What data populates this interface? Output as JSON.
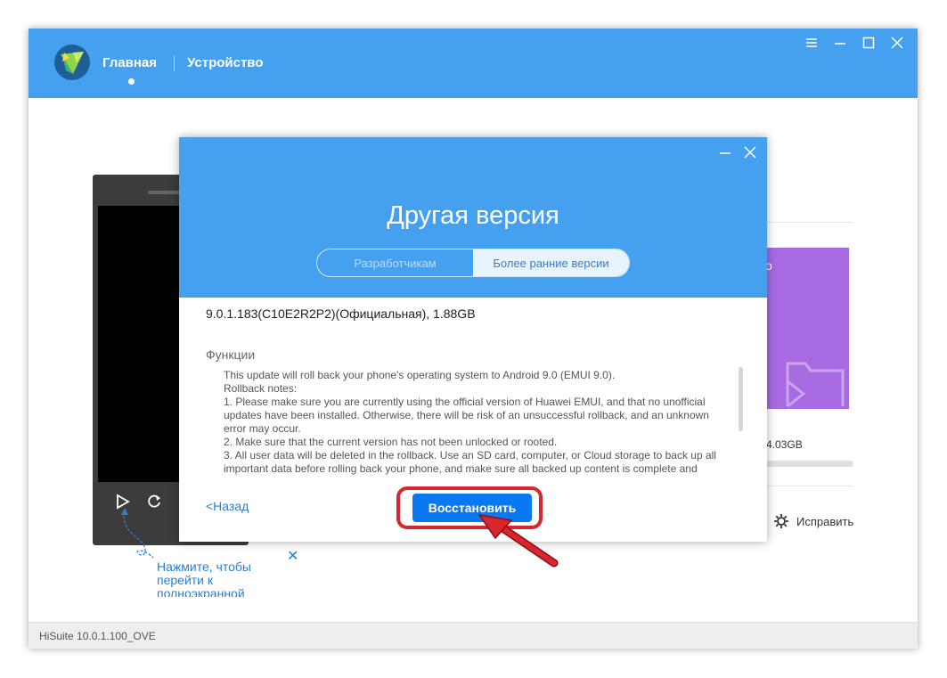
{
  "app": {
    "nav_home": "Главная",
    "nav_device": "Устройство",
    "status_version": "HiSuite 10.0.1.100_OVE"
  },
  "colors": {
    "accent": "#46a0f0",
    "button": "#0a78f0",
    "highlight": "#d8252e",
    "purple": "#a76ae0"
  },
  "background": {
    "purple_card_text": "о",
    "storage_text": "4.03GB",
    "repair_label": "Исправить",
    "hint_text": "Нажмите, чтобы перейти к полноэкранной",
    "hint_close": "✕"
  },
  "dialog": {
    "title": "Другая версия",
    "tabs": [
      {
        "label": "Разработчикам",
        "active": false
      },
      {
        "label": "Более ранние версии",
        "active": true
      }
    ],
    "version": "9.0.1.183(C10E2R2P2)(Официальная), 1.88GB",
    "features_label": "Функции",
    "notes": [
      "This update will roll back your phone's operating system to Android 9.0 (EMUI 9.0).",
      "Rollback notes:",
      "1. Please make sure you are currently using the official version of Huawei EMUI, and that no unofficial updates have been installed. Otherwise, there will be risk of an unsuccessful rollback, and an unknown error may occur.",
      "2. Make sure that the current version has not been unlocked or rooted.",
      "3. All user data will be deleted in the rollback. Use an SD card, computer, or Cloud storage to back up all important data before rolling back your phone, and make sure all backed up content is complete and"
    ],
    "back_label": "<Назад",
    "restore_label": "Восстановить"
  }
}
